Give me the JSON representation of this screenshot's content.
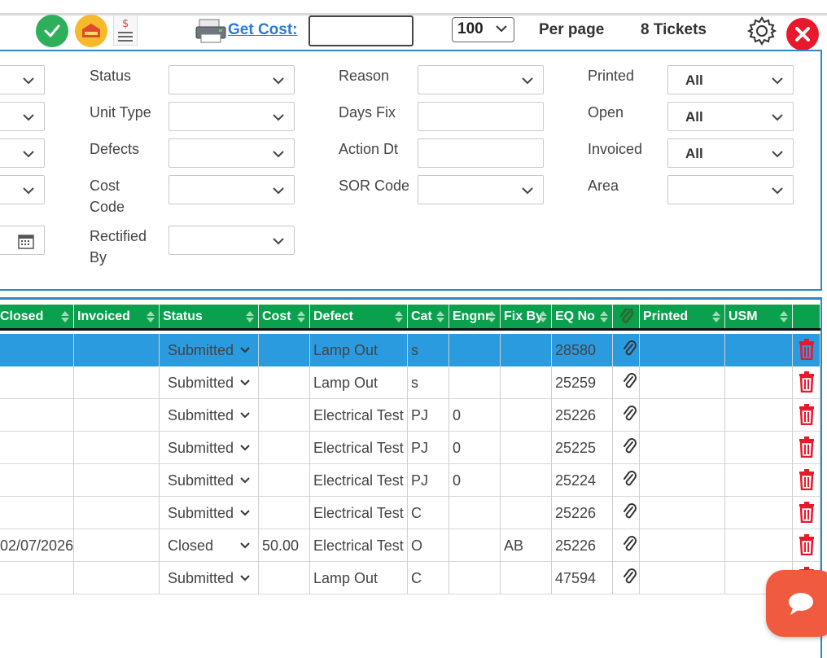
{
  "toolbar": {
    "get_cost_label": "Get Cost:",
    "cost_value": "",
    "per_page_value": "100",
    "per_page_label": "Per page",
    "ticket_count": "8 Tickets"
  },
  "filters": {
    "status_label": "Status",
    "unit_type_label": "Unit Type",
    "defects_label": "Defects",
    "cost_code_label": "Cost\nCode",
    "rectified_by_label": "Rectified\nBy",
    "reason_label": "Reason",
    "days_fix_label": "Days Fix",
    "action_dt_label": "Action Dt",
    "sor_code_label": "SOR Code",
    "printed_label": "Printed",
    "printed_value": "All",
    "open_label": "Open",
    "open_value": "All",
    "invoiced_label": "Invoiced",
    "invoiced_value": "All",
    "area_label": "Area"
  },
  "grid": {
    "columns": [
      "Closed",
      "Invoiced",
      "Status",
      "Cost",
      "Defect",
      "Cat",
      "Engnr",
      "Fix By",
      "EQ No",
      "",
      "Printed",
      "USM",
      ""
    ],
    "rows": [
      {
        "closed": "",
        "invoiced": "",
        "status": "Submitted",
        "cost": "",
        "defect": "Lamp Out",
        "cat": "s",
        "engnr": "",
        "fixby": "",
        "eq": "28580",
        "printed": "",
        "usm": ""
      },
      {
        "closed": "",
        "invoiced": "",
        "status": "Submitted",
        "cost": "",
        "defect": "Lamp Out",
        "cat": "s",
        "engnr": "",
        "fixby": "",
        "eq": "25259",
        "printed": "",
        "usm": ""
      },
      {
        "closed": "",
        "invoiced": "",
        "status": "Submitted",
        "cost": "",
        "defect": "Electrical Test",
        "cat": "PJ",
        "engnr": "0",
        "fixby": "",
        "eq": "25226",
        "printed": "",
        "usm": ""
      },
      {
        "closed": "",
        "invoiced": "",
        "status": "Submitted",
        "cost": "",
        "defect": "Electrical Test",
        "cat": "PJ",
        "engnr": "0",
        "fixby": "",
        "eq": "25225",
        "printed": "",
        "usm": ""
      },
      {
        "closed": "",
        "invoiced": "",
        "status": "Submitted",
        "cost": "",
        "defect": "Electrical Test",
        "cat": "PJ",
        "engnr": "0",
        "fixby": "",
        "eq": "25224",
        "printed": "",
        "usm": ""
      },
      {
        "closed": "",
        "invoiced": "",
        "status": "Submitted",
        "cost": "",
        "defect": "Electrical Test",
        "cat": "C",
        "engnr": "",
        "fixby": "",
        "eq": "25226",
        "printed": "",
        "usm": ""
      },
      {
        "closed": "02/07/2026",
        "invoiced": "",
        "status": "Closed",
        "cost": "50.00",
        "defect": "Electrical Test",
        "cat": "O",
        "engnr": "",
        "fixby": "AB",
        "eq": "25226",
        "printed": "",
        "usm": ""
      },
      {
        "closed": "",
        "invoiced": "",
        "status": "Submitted",
        "cost": "",
        "defect": "Lamp Out",
        "cat": "C",
        "engnr": "",
        "fixby": "",
        "eq": "47594",
        "printed": "",
        "usm": ""
      }
    ]
  },
  "colors": {
    "accent": "#2e86c9",
    "header_green": "#0aa04e",
    "selected_row": "#2b9be0",
    "delete_red": "#e8192c",
    "chat": "#f05b3f"
  }
}
